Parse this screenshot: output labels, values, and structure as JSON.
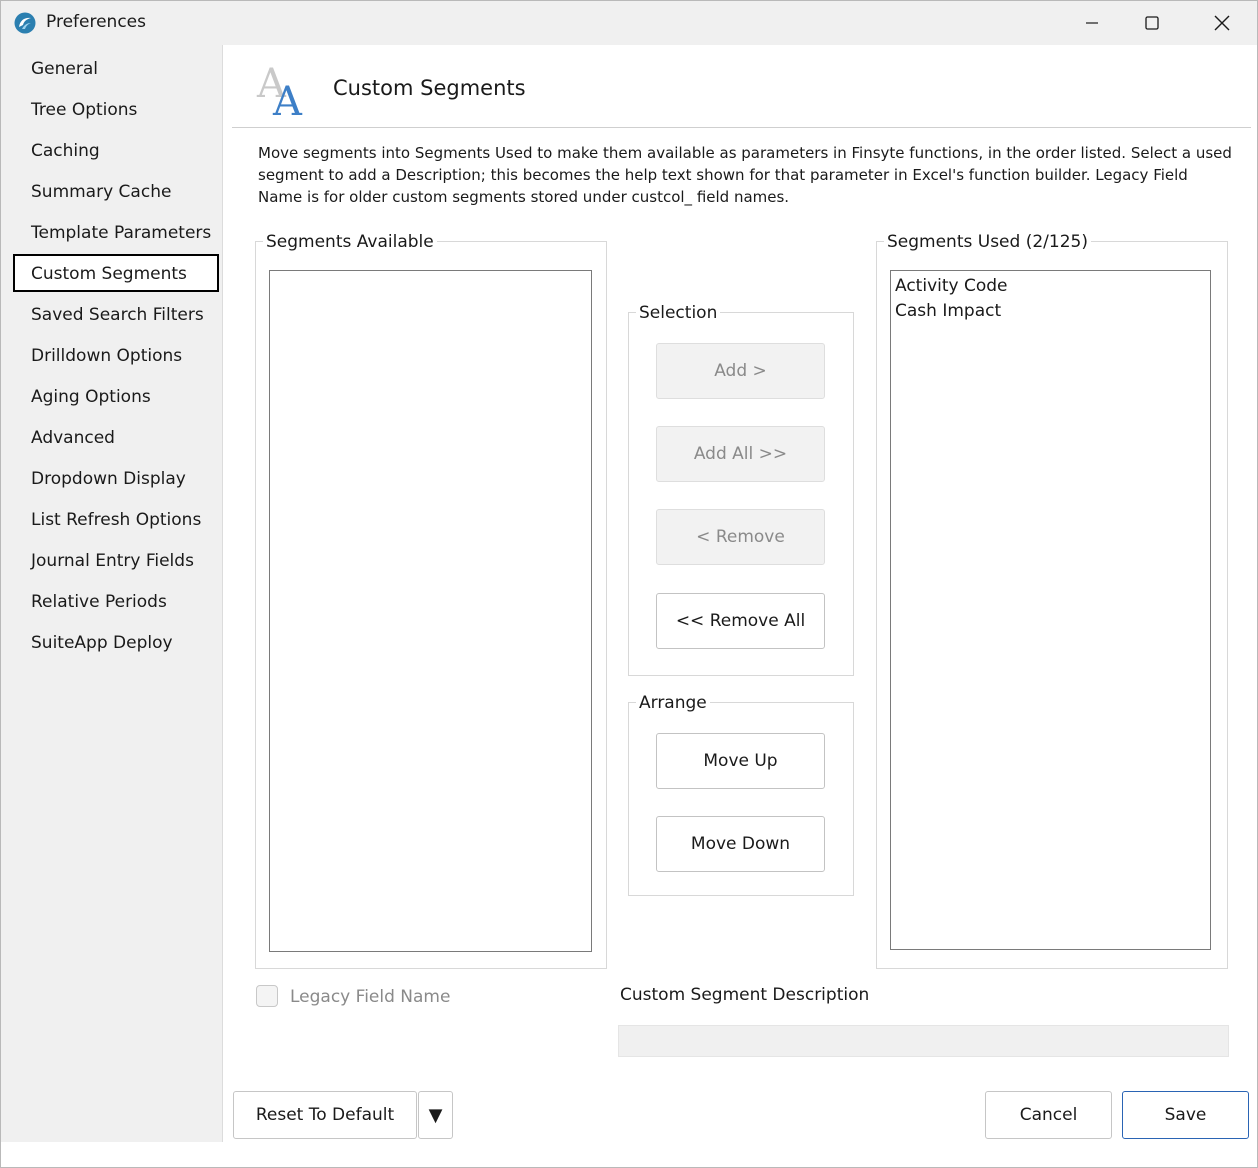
{
  "window": {
    "title": "Preferences"
  },
  "sidebar": {
    "items": [
      {
        "label": "General"
      },
      {
        "label": "Tree Options"
      },
      {
        "label": "Caching"
      },
      {
        "label": "Summary Cache"
      },
      {
        "label": "Template Parameters"
      },
      {
        "label": "Custom Segments",
        "selected": true
      },
      {
        "label": "Saved Search Filters"
      },
      {
        "label": "Drilldown Options"
      },
      {
        "label": "Aging Options"
      },
      {
        "label": "Advanced"
      },
      {
        "label": "Dropdown Display"
      },
      {
        "label": "List Refresh Options"
      },
      {
        "label": "Journal Entry Fields"
      },
      {
        "label": "Relative Periods"
      },
      {
        "label": "SuiteApp Deploy"
      }
    ]
  },
  "page": {
    "title": "Custom Segments",
    "description": "Move segments into Segments Used to make them available as parameters in Finsyte functions, in the order listed. Select a used segment to add a Description; this becomes the help text shown for that parameter in Excel's function builder. Legacy Field Name is for older custom segments stored under custcol_ field names."
  },
  "available": {
    "label": "Segments Available",
    "items": []
  },
  "used": {
    "label": "Segments Used (2/125)",
    "items": [
      "Activity Code",
      "Cash Impact"
    ]
  },
  "selection": {
    "label": "Selection",
    "add": "Add >",
    "add_all": "Add All >>",
    "remove": "< Remove",
    "remove_all": "<< Remove All"
  },
  "arrange": {
    "label": "Arrange",
    "move_up": "Move Up",
    "move_down": "Move Down"
  },
  "legacy": {
    "label": "Legacy Field Name",
    "checked": false
  },
  "description_field": {
    "label": "Custom Segment Description",
    "value": ""
  },
  "footer": {
    "reset": "Reset To Default",
    "dropdown": "▼",
    "cancel": "Cancel",
    "save": "Save"
  },
  "colors": {
    "accent": "#2a64b4",
    "icon_blue": "#3d7fc7"
  }
}
